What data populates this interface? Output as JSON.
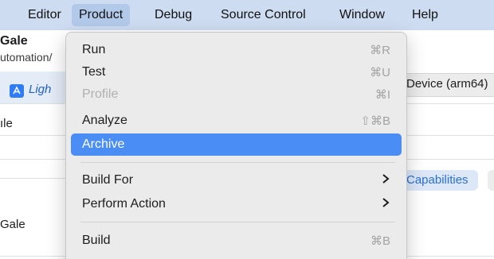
{
  "menubar": {
    "items": [
      "Editor",
      "Product",
      "Debug",
      "Source Control",
      "Window",
      "Help"
    ],
    "active": "Product"
  },
  "background": {
    "project_name": "Gale",
    "project_subtitle": "utomation/",
    "target_label": "Ligh",
    "row_ale": "ıle",
    "row_gale": "Gale",
    "device_label": "Device (arm64)",
    "capabilities_label": "Capabilities"
  },
  "product_menu": {
    "items": [
      {
        "label": "Run",
        "shortcut": "⌘R",
        "state": "enabled"
      },
      {
        "label": "Test",
        "shortcut": "⌘U",
        "state": "enabled"
      },
      {
        "label": "Profile",
        "shortcut": "⌘I",
        "state": "disabled"
      },
      {
        "label": "Analyze",
        "shortcut": "⇧⌘B",
        "state": "enabled"
      },
      {
        "label": "Archive",
        "shortcut": "",
        "state": "highlighted"
      },
      {
        "label": "Build For",
        "submenu": true
      },
      {
        "label": "Perform Action",
        "submenu": true
      },
      {
        "label": "Build",
        "shortcut": "⌘B",
        "state": "enabled"
      }
    ]
  },
  "colors": {
    "menubar_bg": "#cddcf1",
    "highlight": "#4a8ef5",
    "accent_blue": "#2a6fd6",
    "menu_bg": "#ebebeb"
  },
  "icons": {
    "submenu": "chevron-right-icon",
    "target": "app-target-icon"
  }
}
